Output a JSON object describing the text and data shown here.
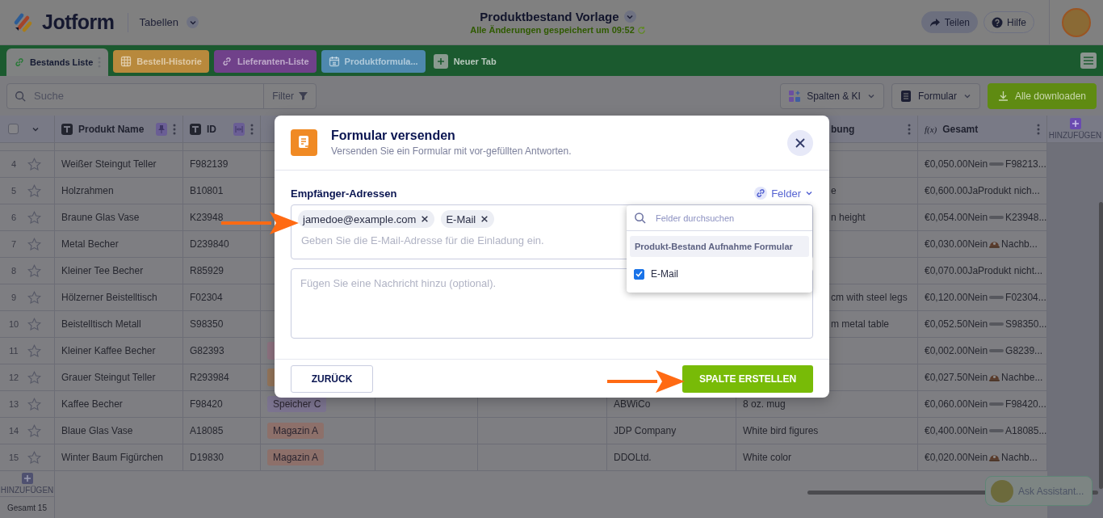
{
  "header": {
    "logo": "Jotform",
    "section": "Tabellen",
    "title": "Produktbestand Vorlage",
    "status": "Alle Änderungen gespeichert um 09:52",
    "buttons": [
      {
        "label": "Teilen",
        "kind": "share"
      },
      {
        "label": "Hilfe",
        "kind": "help"
      }
    ]
  },
  "tabs": [
    {
      "label": "Bestands Liste",
      "kind": "link",
      "selected": true,
      "color": "#808282"
    },
    {
      "label": "Bestell-Historie",
      "kind": "grid",
      "selected": false,
      "color": "#b8893c"
    },
    {
      "label": "Lieferanten-Liste",
      "kind": "link",
      "selected": false,
      "color": "#70418a"
    },
    {
      "label": "Produktformula...",
      "kind": "calendar",
      "selected": false,
      "color": "#4e88ae"
    }
  ],
  "new_tab": "Neuer Tab",
  "toolbar": {
    "search": {
      "placeholder": "Suche"
    },
    "filter": "Filter",
    "buttons": [
      {
        "label": "Spalten & KI",
        "kind": "columns"
      },
      {
        "label": "Formular",
        "kind": "form"
      },
      {
        "label": "Alle downloaden",
        "kind": "download"
      }
    ]
  },
  "table": {
    "select_all_checked": false,
    "columns": [
      {
        "label": "Produkt Name",
        "kind": "text"
      },
      {
        "label": "ID",
        "kind": "text"
      },
      {
        "label": "bung",
        "kind": "fragment"
      },
      {
        "label": "Gesamt",
        "kind": "formula",
        "prefix": "f(x)"
      }
    ],
    "add_column": "HINZUFÜGEN",
    "rows": [
      {
        "number": "4",
        "starred": false,
        "name": "Weißer Steingut Teller",
        "id": "F982139",
        "total": {
          "text": "€0,050.00Nein",
          "kind": "dash",
          "rest": "F98213..."
        }
      },
      {
        "number": "5",
        "starred": false,
        "name": "Holzrahmen",
        "id": "B10801",
        "description": "e",
        "total": {
          "text": "€0,600.00JaProdukt nich...",
          "kind": "plain"
        }
      },
      {
        "number": "6",
        "starred": false,
        "name": "Braune Glas Vase",
        "id": "K23948",
        "description": "n height",
        "total": {
          "text": "€0,054.00Nein",
          "kind": "dash",
          "rest": "K23948..."
        }
      },
      {
        "number": "7",
        "starred": false,
        "name": "Metal Becher",
        "id": "D239840",
        "total": {
          "text": "€0,030.00Nein",
          "kind": "bell",
          "rest": "Nachb..."
        }
      },
      {
        "number": "8",
        "starred": false,
        "name": "Kleiner Tee Becher",
        "id": "R85929",
        "total": {
          "text": "€0,070.00JaProdukt nicht...",
          "kind": "plain"
        }
      },
      {
        "number": "9",
        "starred": false,
        "name": "Hölzerner Beistelltisch",
        "id": "F02304",
        "description": "cm with steel legs",
        "total": {
          "text": "€0,120.00Nein",
          "kind": "dash",
          "rest": "F02304..."
        }
      },
      {
        "number": "10",
        "starred": false,
        "name": "Beistelltisch Metall",
        "id": "S98350",
        "description": "m metal table",
        "total": {
          "text": "€0,052.50Nein",
          "kind": "dash",
          "rest": "S98350..."
        }
      },
      {
        "number": "11",
        "starred": false,
        "name": "Kleiner Kaffee Becher",
        "id": "G82393",
        "tag": {
          "color": "#8e7280"
        },
        "total": {
          "text": "€0,002.00Nein",
          "kind": "dash",
          "rest": "G8239..."
        }
      },
      {
        "number": "12",
        "starred": false,
        "name": "Grauer Steingut Teller",
        "id": "R293984",
        "tag": {
          "color": "#94755a"
        },
        "total": {
          "text": "€0,027.50Nein",
          "kind": "bell",
          "rest": "Nachbe..."
        }
      },
      {
        "number": "13",
        "starred": false,
        "name": "Kaffee Becher",
        "id": "F98420",
        "tag": {
          "text": "Speicher C",
          "color": "#7c7490"
        },
        "supplier": "ABWiCo",
        "description": "8 oz. mug",
        "total": {
          "text": "€0,060.00Nein",
          "kind": "dash",
          "rest": "F98420..."
        }
      },
      {
        "number": "14",
        "starred": false,
        "name": "Blaue Glas Vase",
        "id": "A18085",
        "tag": {
          "text": "Magazin A",
          "color": "#8d706a"
        },
        "supplier": "JDP Company",
        "description": "White bird figures",
        "total": {
          "text": "€0,400.00Nein",
          "kind": "dash",
          "rest": "A18085..."
        }
      },
      {
        "number": "15",
        "starred": false,
        "name": "Winter Baum Figürchen",
        "id": "D19830",
        "tag": {
          "text": "Magazin A",
          "color": "#8d706a"
        },
        "supplier": "DDOLtd.",
        "description": "White color",
        "total": {
          "text": "€0,020.00Nein",
          "kind": "bell",
          "rest": "Nachb..."
        }
      }
    ],
    "add_row": "HINZUFÜGEN",
    "total_count": "Gesamt 15"
  },
  "dialog": {
    "title": "Formular versenden",
    "subtitle": "Versenden Sie ein Formular mit vor-gefüllten Antworten.",
    "recipients_label": "Empfänger-Adressen",
    "fields_link": "Felder",
    "recipients": [
      {
        "text": "jamedoe@example.com"
      },
      {
        "text": "E-Mail"
      }
    ],
    "recipient_input": {
      "placeholder": "Geben Sie die E-Mail-Adresse für die Einladung ein."
    },
    "message": {
      "placeholder": "Fügen Sie eine Nachricht hinzu (optional)."
    },
    "buttons": [
      {
        "label": "ZURÜCK",
        "kind": "secondary"
      },
      {
        "label": "SPALTE ERSTELLEN",
        "kind": "primary"
      }
    ]
  },
  "field_menu": {
    "search": {
      "placeholder": "Felder durchsuchen"
    },
    "group": "Produkt-Bestand Aufnahme Formular",
    "options": [
      {
        "label": "E-Mail",
        "checked": true
      }
    ]
  },
  "assistant": "Ask Assistant..."
}
